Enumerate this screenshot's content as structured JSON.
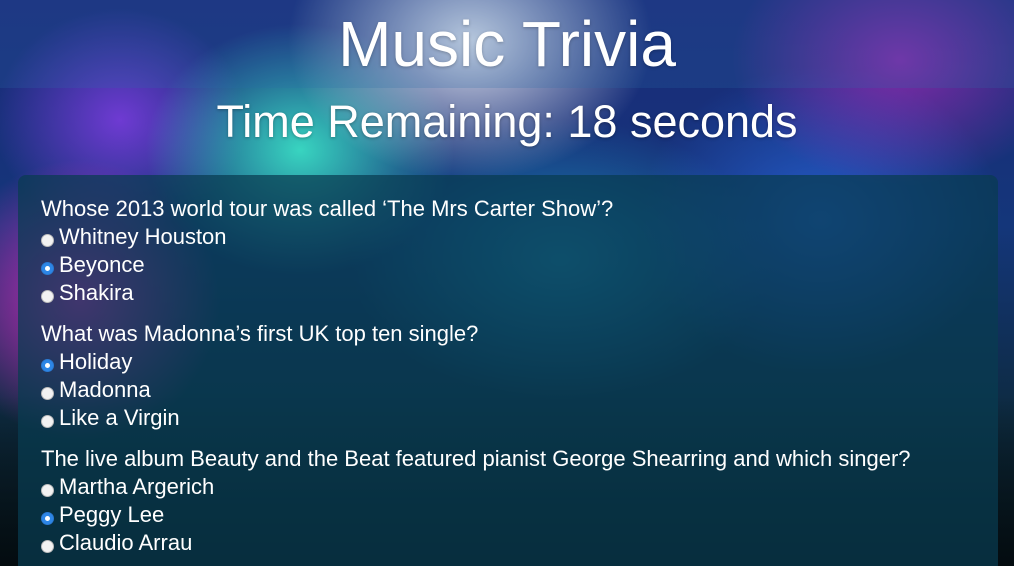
{
  "header": {
    "title": "Music Trivia",
    "timer": "Time Remaining: 18 seconds"
  },
  "questions": [
    {
      "text": "Whose 2013 world tour was called ‘The Mrs Carter Show’?",
      "choices": [
        {
          "label": "Whitney Houston",
          "selected": false
        },
        {
          "label": "Beyonce",
          "selected": true
        },
        {
          "label": "Shakira",
          "selected": false
        }
      ]
    },
    {
      "text": "What was Madonna’s first UK top ten single?",
      "choices": [
        {
          "label": "Holiday",
          "selected": true
        },
        {
          "label": "Madonna",
          "selected": false
        },
        {
          "label": "Like a Virgin",
          "selected": false
        }
      ]
    },
    {
      "text": "The live album Beauty and the Beat featured pianist George Shearring and which singer?",
      "choices": [
        {
          "label": "Martha Argerich",
          "selected": false
        },
        {
          "label": "Peggy Lee",
          "selected": true
        },
        {
          "label": "Claudio Arrau",
          "selected": false
        }
      ]
    }
  ],
  "colors": {
    "radio_selected": "#2d86e6",
    "radio_unselected": "#f2f2f2",
    "panel": "#083c50"
  }
}
